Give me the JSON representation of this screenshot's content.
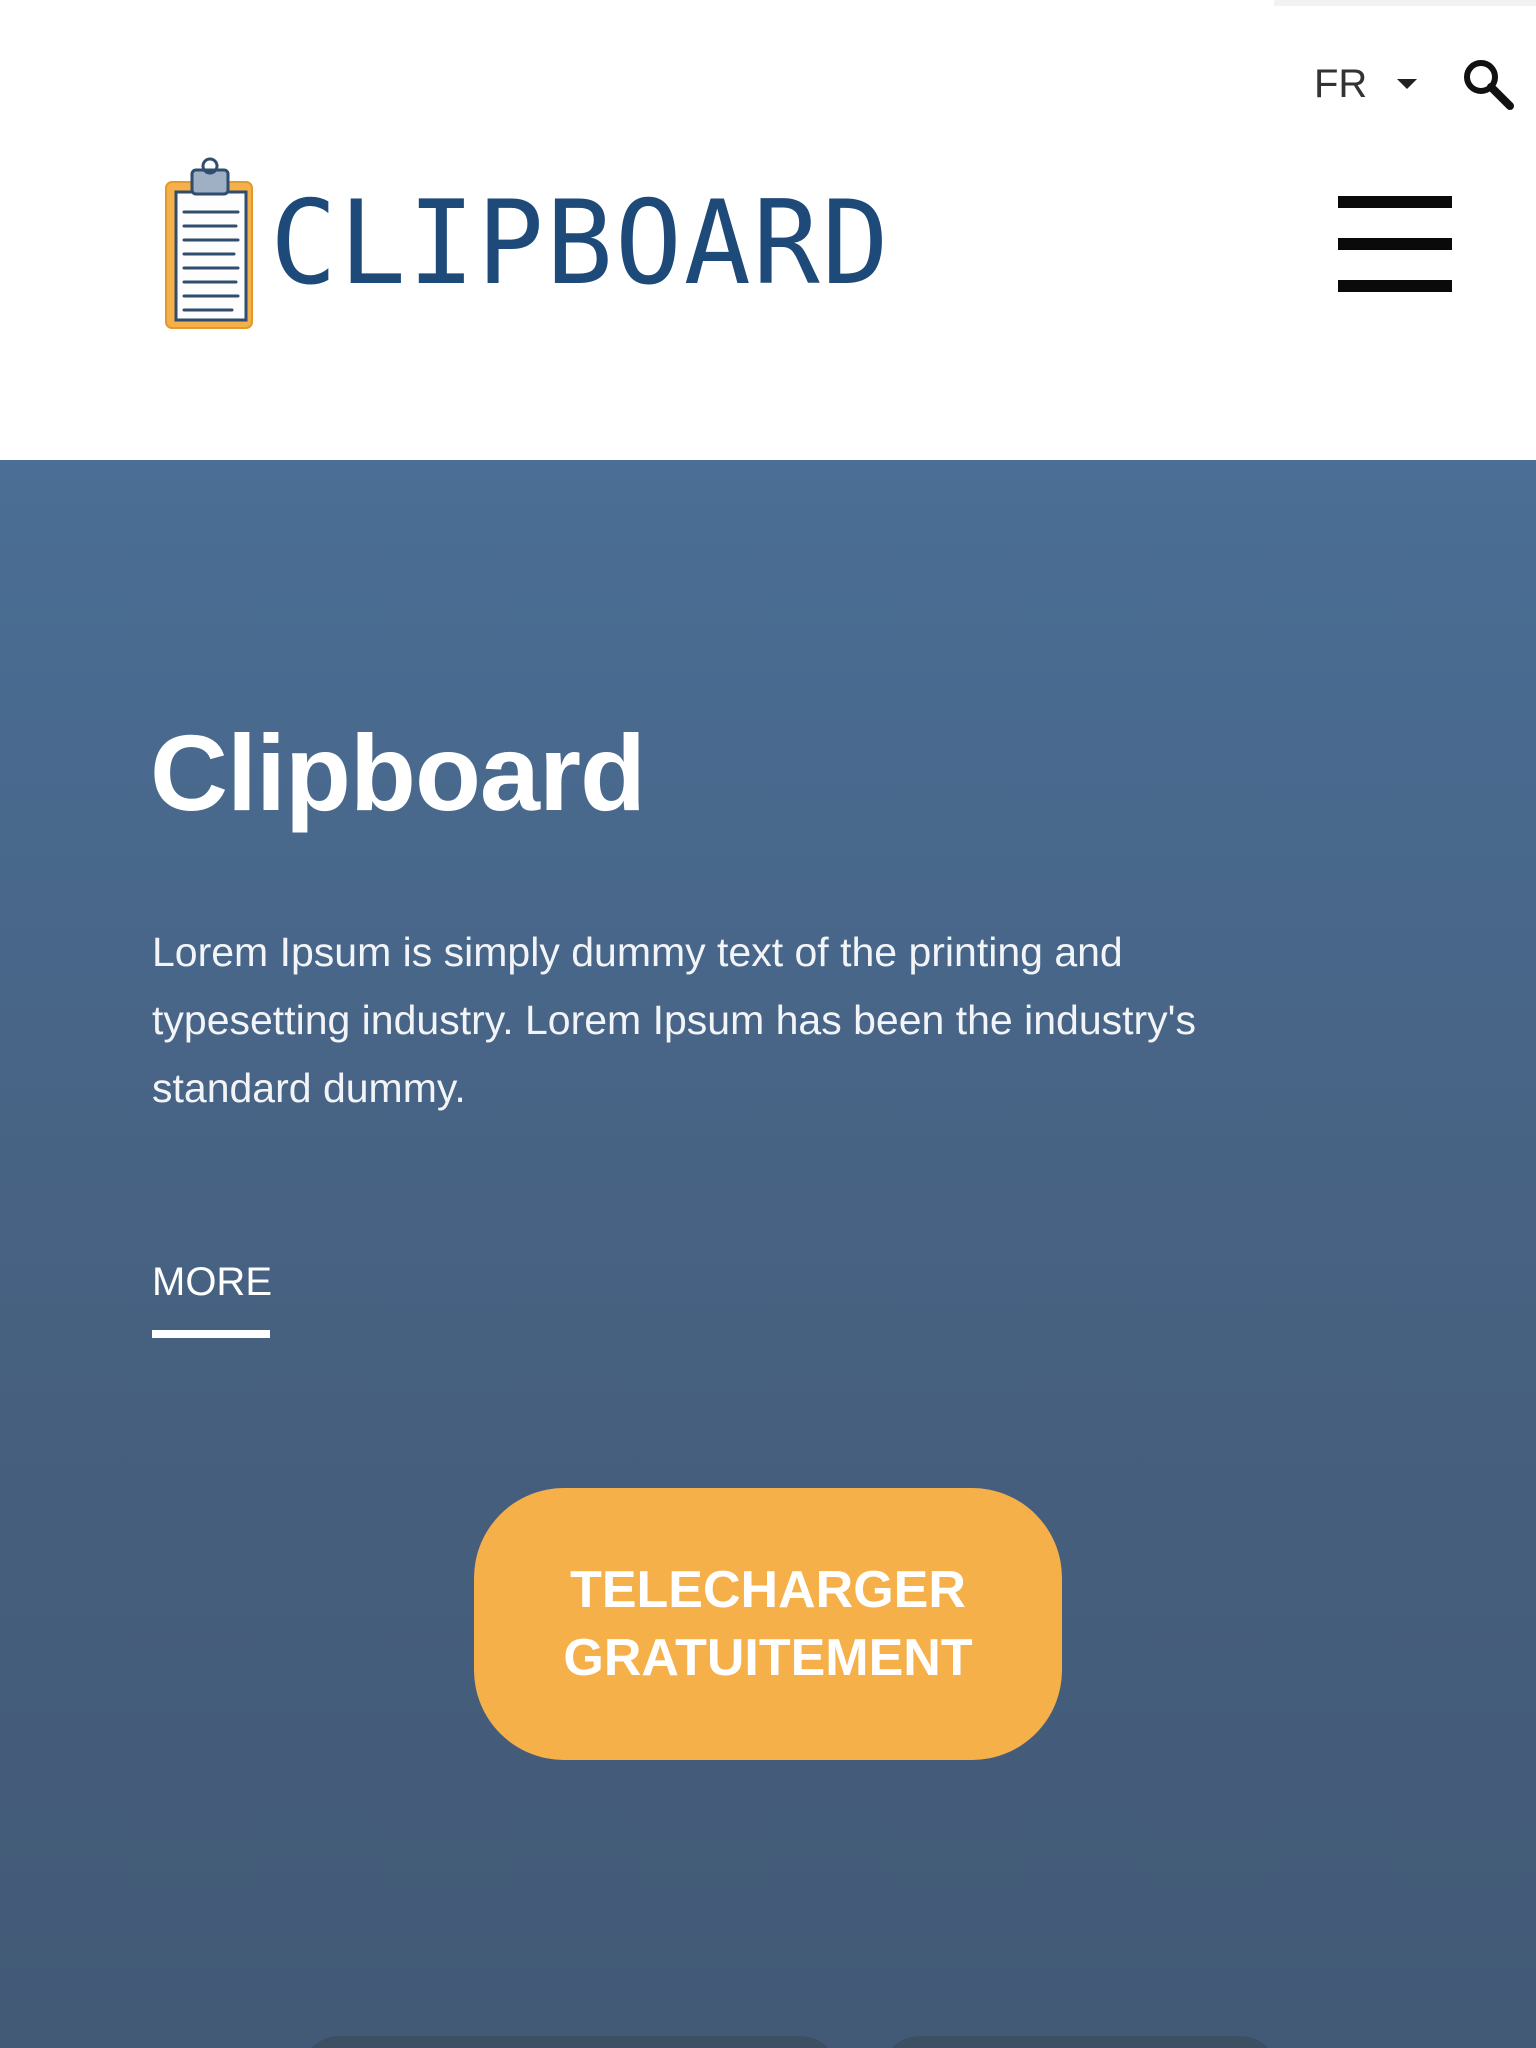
{
  "header": {
    "language": {
      "label": "FR",
      "caret_icon": "caret-down-icon"
    },
    "search_icon": "search-icon",
    "logo": {
      "text": "CLIPBOARD",
      "icon": "clipboard-icon",
      "text_color": "#1e4a7a"
    },
    "menu_icon": "hamburger-menu-icon"
  },
  "hero": {
    "title": "Clipboard",
    "description": "Lorem Ipsum is simply dummy text of the printing and typesetting industry. Lorem Ipsum has been the industry's standard dummy.",
    "more_label": "MORE",
    "cta_label": "TELECHARGER\nGRATUITEMENT",
    "background_color": "#486a90",
    "cta_color": "#f6b04a"
  }
}
